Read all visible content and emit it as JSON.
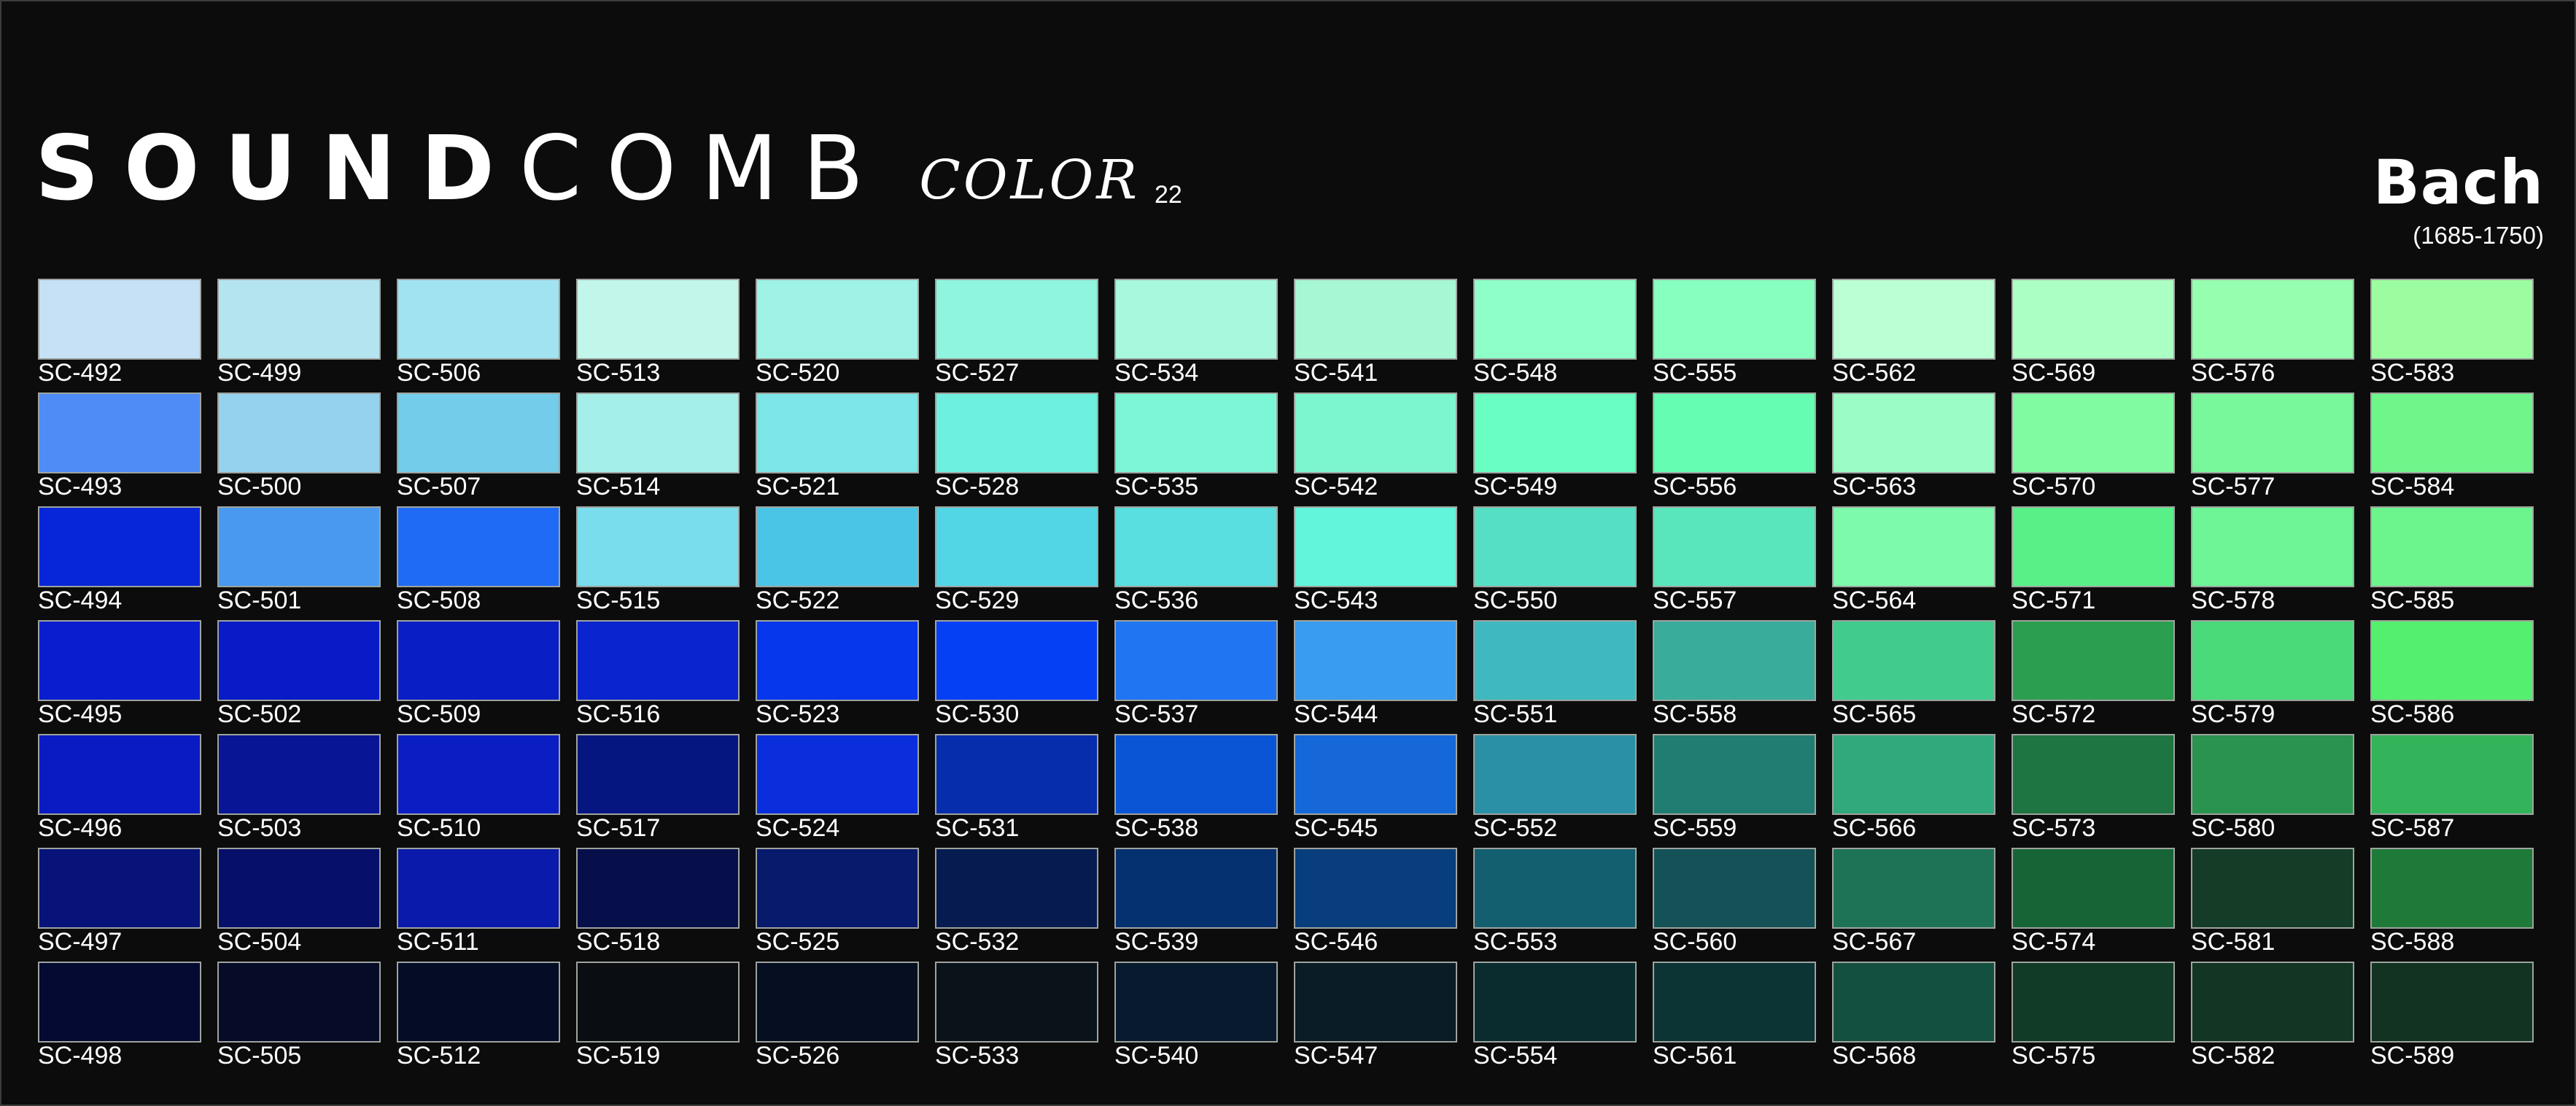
{
  "brand": {
    "logo_bold": "SOUND",
    "logo_light": "COMB",
    "sub": "COLOR",
    "number": "22"
  },
  "composer": {
    "name": "Bach",
    "years": "(1685-1750)"
  },
  "chart_data": {
    "type": "table",
    "title": "",
    "columns": 14,
    "rows": 7,
    "order": "column-major",
    "swatches": [
      {
        "code": "SC-492",
        "color": "#c6e1f5"
      },
      {
        "code": "SC-493",
        "color": "#4f8cf5"
      },
      {
        "code": "SC-494",
        "color": "#0726da"
      },
      {
        "code": "SC-495",
        "color": "#0a1ed0"
      },
      {
        "code": "SC-496",
        "color": "#0b1bc3"
      },
      {
        "code": "SC-497",
        "color": "#071379"
      },
      {
        "code": "SC-498",
        "color": "#050a33"
      },
      {
        "code": "SC-499",
        "color": "#b5e4f1"
      },
      {
        "code": "SC-500",
        "color": "#95d2ee"
      },
      {
        "code": "SC-501",
        "color": "#4899ef"
      },
      {
        "code": "SC-502",
        "color": "#081bc7"
      },
      {
        "code": "SC-503",
        "color": "#081594"
      },
      {
        "code": "SC-504",
        "color": "#060f6a"
      },
      {
        "code": "SC-505",
        "color": "#060b28"
      },
      {
        "code": "SC-506",
        "color": "#a1e3f0"
      },
      {
        "code": "SC-507",
        "color": "#72ccea"
      },
      {
        "code": "SC-508",
        "color": "#1f6bf5"
      },
      {
        "code": "SC-509",
        "color": "#0a1ec5"
      },
      {
        "code": "SC-510",
        "color": "#0a1ec3"
      },
      {
        "code": "SC-511",
        "color": "#0a1aab"
      },
      {
        "code": "SC-512",
        "color": "#050c26"
      },
      {
        "code": "SC-513",
        "color": "#c2f6ea"
      },
      {
        "code": "SC-514",
        "color": "#a4efe9"
      },
      {
        "code": "SC-515",
        "color": "#79dded"
      },
      {
        "code": "SC-516",
        "color": "#0a24cf"
      },
      {
        "code": "SC-517",
        "color": "#061680"
      },
      {
        "code": "SC-518",
        "color": "#060f4a"
      },
      {
        "code": "SC-519",
        "color": "#0a0e12"
      },
      {
        "code": "SC-520",
        "color": "#9ef2e6"
      },
      {
        "code": "SC-521",
        "color": "#7ce6e8"
      },
      {
        "code": "SC-522",
        "color": "#4bc5e6"
      },
      {
        "code": "SC-523",
        "color": "#0637ed"
      },
      {
        "code": "SC-524",
        "color": "#0a2edc"
      },
      {
        "code": "SC-525",
        "color": "#081a6c"
      },
      {
        "code": "SC-526",
        "color": "#060f22"
      },
      {
        "code": "SC-527",
        "color": "#8ff5de"
      },
      {
        "code": "SC-528",
        "color": "#6ef0e0"
      },
      {
        "code": "SC-529",
        "color": "#52d6e6"
      },
      {
        "code": "SC-530",
        "color": "#0640f5"
      },
      {
        "code": "SC-531",
        "color": "#062dac"
      },
      {
        "code": "SC-532",
        "color": "#061c50"
      },
      {
        "code": "SC-533",
        "color": "#0a121a"
      },
      {
        "code": "SC-534",
        "color": "#a7f8dc"
      },
      {
        "code": "SC-535",
        "color": "#7cf7d6"
      },
      {
        "code": "SC-536",
        "color": "#59dfe0"
      },
      {
        "code": "SC-537",
        "color": "#1f75f2"
      },
      {
        "code": "SC-538",
        "color": "#0a55d6"
      },
      {
        "code": "SC-539",
        "color": "#063170"
      },
      {
        "code": "SC-540",
        "color": "#081a2e"
      },
      {
        "code": "SC-541",
        "color": "#a7f7d4"
      },
      {
        "code": "SC-542",
        "color": "#7bf6cf"
      },
      {
        "code": "SC-543",
        "color": "#62f5db"
      },
      {
        "code": "SC-544",
        "color": "#3a9cef"
      },
      {
        "code": "SC-545",
        "color": "#1668d9"
      },
      {
        "code": "SC-546",
        "color": "#083e7b"
      },
      {
        "code": "SC-547",
        "color": "#0a1c25"
      },
      {
        "code": "SC-548",
        "color": "#8effc8"
      },
      {
        "code": "SC-549",
        "color": "#6affc2"
      },
      {
        "code": "SC-550",
        "color": "#55e0c6"
      },
      {
        "code": "SC-551",
        "color": "#3fb9bf"
      },
      {
        "code": "SC-552",
        "color": "#2a90a6"
      },
      {
        "code": "SC-553",
        "color": "#135e6f"
      },
      {
        "code": "SC-554",
        "color": "#0a2c2f"
      },
      {
        "code": "SC-555",
        "color": "#87ffbf"
      },
      {
        "code": "SC-556",
        "color": "#64fdb1"
      },
      {
        "code": "SC-557",
        "color": "#5ae6bd"
      },
      {
        "code": "SC-558",
        "color": "#3aac9c"
      },
      {
        "code": "SC-559",
        "color": "#217d72"
      },
      {
        "code": "SC-560",
        "color": "#145258"
      },
      {
        "code": "SC-561",
        "color": "#0c3435"
      },
      {
        "code": "SC-562",
        "color": "#bbffd4"
      },
      {
        "code": "SC-563",
        "color": "#9bfcc5"
      },
      {
        "code": "SC-564",
        "color": "#7dfaac"
      },
      {
        "code": "SC-565",
        "color": "#41cc8e"
      },
      {
        "code": "SC-566",
        "color": "#32a87d"
      },
      {
        "code": "SC-567",
        "color": "#1e7357"
      },
      {
        "code": "SC-568",
        "color": "#145040"
      },
      {
        "code": "SC-569",
        "color": "#abffc4"
      },
      {
        "code": "SC-570",
        "color": "#80fba2"
      },
      {
        "code": "SC-571",
        "color": "#58f187"
      },
      {
        "code": "SC-572",
        "color": "#2c9e4f"
      },
      {
        "code": "SC-573",
        "color": "#1e7541"
      },
      {
        "code": "SC-574",
        "color": "#176536"
      },
      {
        "code": "SC-575",
        "color": "#113b27"
      },
      {
        "code": "SC-576",
        "color": "#95ffaf"
      },
      {
        "code": "SC-577",
        "color": "#78f89a"
      },
      {
        "code": "SC-578",
        "color": "#6df596"
      },
      {
        "code": "SC-579",
        "color": "#4bda7a"
      },
      {
        "code": "SC-580",
        "color": "#2a9350"
      },
      {
        "code": "SC-581",
        "color": "#143c26"
      },
      {
        "code": "SC-582",
        "color": "#123524"
      },
      {
        "code": "SC-583",
        "color": "#9cfda0"
      },
      {
        "code": "SC-584",
        "color": "#6ff68a"
      },
      {
        "code": "SC-585",
        "color": "#6cf58c"
      },
      {
        "code": "SC-586",
        "color": "#55ef6f"
      },
      {
        "code": "SC-587",
        "color": "#33b45a"
      },
      {
        "code": "SC-588",
        "color": "#1e7a38"
      },
      {
        "code": "SC-589",
        "color": "#123321"
      }
    ]
  }
}
